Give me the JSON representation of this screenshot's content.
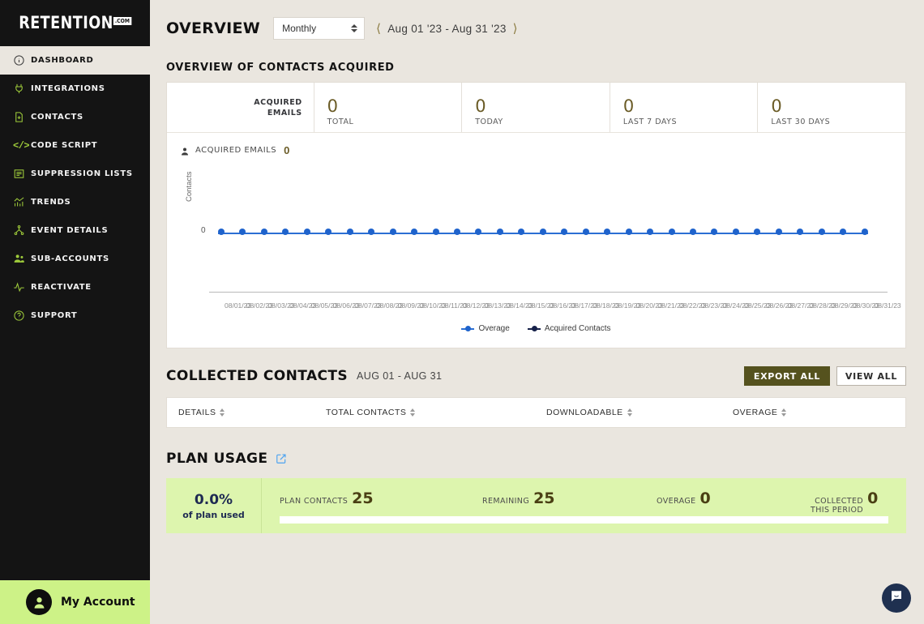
{
  "sidebar": {
    "brand": {
      "name": "RETENTION",
      "suffix": ".COM"
    },
    "items": [
      {
        "label": "DASHBOARD",
        "icon": "info-circle-icon",
        "active": true
      },
      {
        "label": "INTEGRATIONS",
        "icon": "plug-icon",
        "active": false
      },
      {
        "label": "CONTACTS",
        "icon": "file-contact-icon",
        "active": false
      },
      {
        "label": "CODE SCRIPT",
        "icon": "code-brackets-icon",
        "active": false
      },
      {
        "label": "SUPPRESSION LISTS",
        "icon": "list-icon",
        "active": false
      },
      {
        "label": "TRENDS",
        "icon": "bar-chart-icon",
        "active": false
      },
      {
        "label": "EVENT DETAILS",
        "icon": "node-graph-icon",
        "active": false
      },
      {
        "label": "SUB-ACCOUNTS",
        "icon": "users-icon",
        "active": false
      },
      {
        "label": "REACTIVATE",
        "icon": "pulse-icon",
        "active": false
      },
      {
        "label": "SUPPORT",
        "icon": "question-circle-icon",
        "active": false
      }
    ],
    "account": {
      "label": "My Account",
      "icon": "avatar-icon"
    }
  },
  "header": {
    "title": "OVERVIEW",
    "period": {
      "value": "Monthly",
      "icon": "spinner-arrows-icon"
    },
    "date_range": "Aug 01 '23 - Aug 31 '23",
    "prev_icon": "chevron-left-icon",
    "next_icon": "chevron-right-icon"
  },
  "overview": {
    "section_title": "OVERVIEW OF CONTACTS ACQUIRED",
    "stats_label_line1": "ACQUIRED",
    "stats_label_line2": "EMAILS",
    "stats": [
      {
        "value": "0",
        "caption": "TOTAL"
      },
      {
        "value": "0",
        "caption": "TODAY"
      },
      {
        "value": "0",
        "caption": "LAST 7 DAYS"
      },
      {
        "value": "0",
        "caption": "LAST 30 DAYS"
      }
    ],
    "acquired_emails_label": "ACQUIRED EMAILS",
    "acquired_emails_value": "0",
    "acquired_icon": "person-icon"
  },
  "chart_data": {
    "type": "line",
    "title": "",
    "xlabel": "",
    "ylabel": "Contacts",
    "ylim": [
      0,
      1
    ],
    "yticks": [
      "0"
    ],
    "grid": false,
    "legend_position": "bottom",
    "x": [
      "08/01/23",
      "08/02/23",
      "08/03/23",
      "08/04/23",
      "08/05/23",
      "08/06/23",
      "08/07/23",
      "08/08/23",
      "08/09/23",
      "08/10/23",
      "08/11/23",
      "08/12/23",
      "08/13/23",
      "08/14/23",
      "08/15/23",
      "08/16/23",
      "08/17/23",
      "08/18/23",
      "08/19/23",
      "08/20/23",
      "08/21/23",
      "08/22/23",
      "08/23/23",
      "08/24/23",
      "08/25/23",
      "08/26/23",
      "08/27/23",
      "08/28/23",
      "08/29/23",
      "08/30/23",
      "08/31/23"
    ],
    "series": [
      {
        "name": "Overage",
        "color": "#1f63cc",
        "values": [
          0,
          0,
          0,
          0,
          0,
          0,
          0,
          0,
          0,
          0,
          0,
          0,
          0,
          0,
          0,
          0,
          0,
          0,
          0,
          0,
          0,
          0,
          0,
          0,
          0,
          0,
          0,
          0,
          0,
          0,
          0
        ]
      },
      {
        "name": "Acquired Contacts",
        "color": "#17214a",
        "values": [
          0,
          0,
          0,
          0,
          0,
          0,
          0,
          0,
          0,
          0,
          0,
          0,
          0,
          0,
          0,
          0,
          0,
          0,
          0,
          0,
          0,
          0,
          0,
          0,
          0,
          0,
          0,
          0,
          0,
          0,
          0
        ]
      }
    ]
  },
  "collected": {
    "title": "COLLECTED CONTACTS",
    "range": "AUG 01 - AUG 31",
    "export_label": "EXPORT ALL",
    "view_label": "VIEW ALL",
    "columns": [
      "DETAILS",
      "TOTAL CONTACTS",
      "DOWNLOADABLE",
      "OVERAGE"
    ],
    "rows": []
  },
  "plan_usage": {
    "title": "PLAN USAGE",
    "edit_icon": "edit-square-icon",
    "percent": "0.0%",
    "percent_caption": "of plan used",
    "metrics": [
      {
        "label": "PLAN CONTACTS",
        "value": "25"
      },
      {
        "label": "REMAINING",
        "value": "25"
      },
      {
        "label": "OVERAGE",
        "value": "0"
      },
      {
        "label_line1": "COLLECTED",
        "label_line2": "THIS PERIOD",
        "value": "0"
      }
    ],
    "progress_percent": 0
  },
  "chat": {
    "icon": "chat-bubble-icon"
  },
  "colors": {
    "page_bg": "#eae6df",
    "sidebar_bg": "#141414",
    "accent_green": "#9fcc3b",
    "account_green": "#cdf287",
    "plan_green": "#ddf5ae",
    "olive": "#55521e",
    "stat_olive": "#6b5c27",
    "line_blue": "#1f63cc",
    "navy": "#17214a"
  }
}
